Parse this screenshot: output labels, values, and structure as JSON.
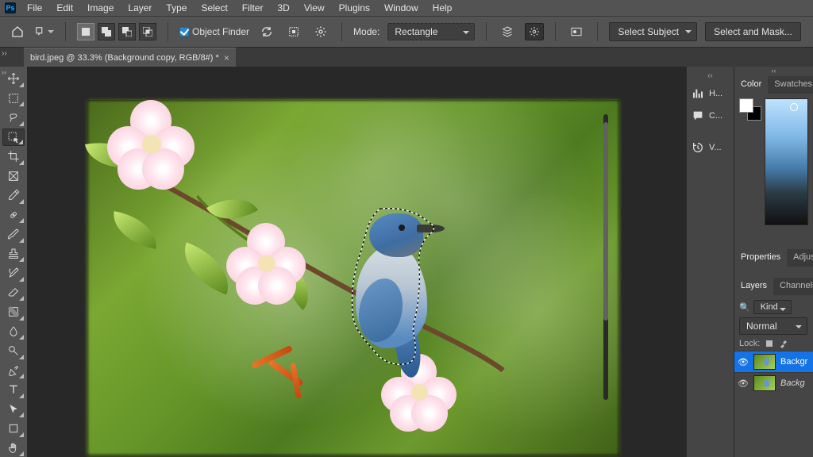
{
  "menu": [
    "File",
    "Edit",
    "Image",
    "Layer",
    "Type",
    "Select",
    "Filter",
    "3D",
    "View",
    "Plugins",
    "Window",
    "Help"
  ],
  "app_logo": "Ps",
  "options": {
    "object_finder": "Object Finder",
    "mode_label": "Mode:",
    "mode_value": "Rectangle",
    "select_subject": "Select Subject",
    "select_and_mask": "Select and Mask..."
  },
  "tab": {
    "title": "bird.jpeg @ 33.3% (Background copy, RGB/8#) *"
  },
  "midpanels": [
    {
      "icon": "histogram",
      "label": "H..."
    },
    {
      "icon": "comment",
      "label": "C..."
    },
    {
      "icon": "history",
      "label": "V..."
    }
  ],
  "panels": {
    "color_tabs": [
      "Color",
      "Swatches"
    ],
    "props_tabs": [
      "Properties",
      "Adjus"
    ],
    "layers_tabs": [
      "Layers",
      "Channels"
    ],
    "kind_label": "Kind",
    "blend_mode": "Normal",
    "lock_label": "Lock:",
    "layers": [
      {
        "name": "Backgr",
        "vis": true,
        "sel": true,
        "italic": false
      },
      {
        "name": "Backg",
        "vis": true,
        "sel": false,
        "italic": true
      }
    ]
  },
  "search_icon": "🔍"
}
